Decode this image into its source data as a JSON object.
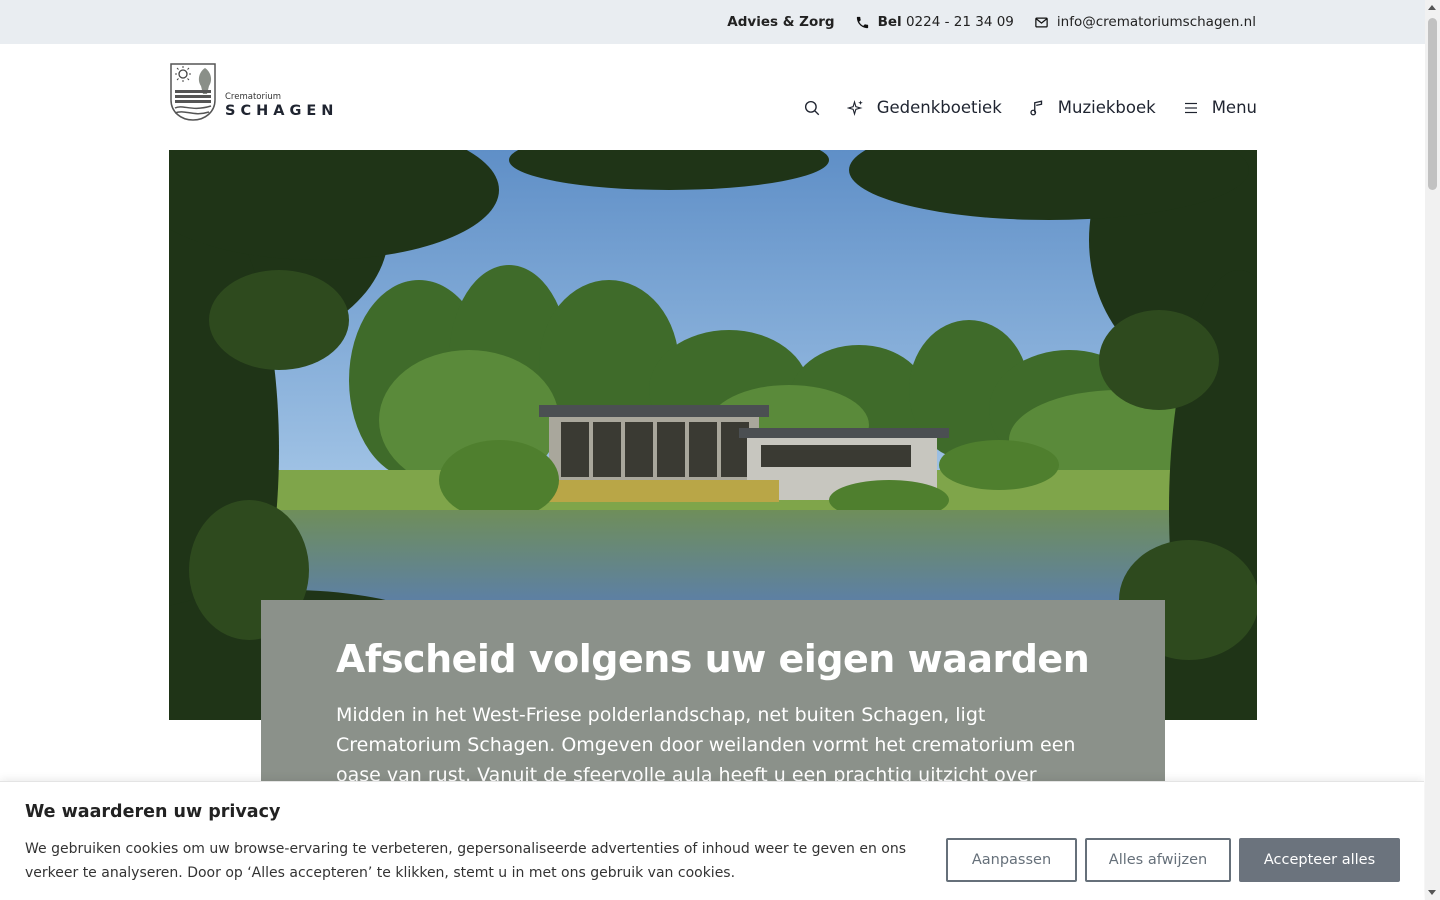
{
  "topbar": {
    "advice_link": "Advies & Zorg",
    "phone_prefix": "Bel",
    "phone_number": "0224 - 21 34 09",
    "email": "info@crematoriumschagen.nl"
  },
  "logo": {
    "small_text": "Crematorium",
    "big_text": "SCHAGEN"
  },
  "nav": {
    "items": [
      {
        "label": "Gedenkboetiek",
        "icon": "sparkle-icon"
      },
      {
        "label": "Muziekboek",
        "icon": "music-note-icon"
      },
      {
        "label": "Menu",
        "icon": "hamburger-icon"
      }
    ]
  },
  "hero": {
    "title": "Afscheid volgens uw eigen waarden",
    "text": "Midden in het West-Friese polderlandschap, net buiten Schagen, ligt Crematorium Schagen. Omgeven door weilanden vormt het crematorium een oase van rust. Vanuit de sfeervolle aula heeft u een prachtig uitzicht over een"
  },
  "cookie": {
    "title": "We waarderen uw privacy",
    "description": "We gebruiken cookies om uw browse-ervaring te verbeteren, gepersonaliseerde advertenties of inhoud weer te geven en ons verkeer te analyseren. Door op ‘Alles accepteren’ te klikken, stemt u in met ons gebruik van cookies.",
    "btn_customize": "Aanpassen",
    "btn_reject": "Alles afwijzen",
    "btn_accept": "Accepteer alles"
  },
  "colors": {
    "topbar_bg": "#e9edf1",
    "card_bg": "#8b918a",
    "button_accent": "#6b737d"
  }
}
